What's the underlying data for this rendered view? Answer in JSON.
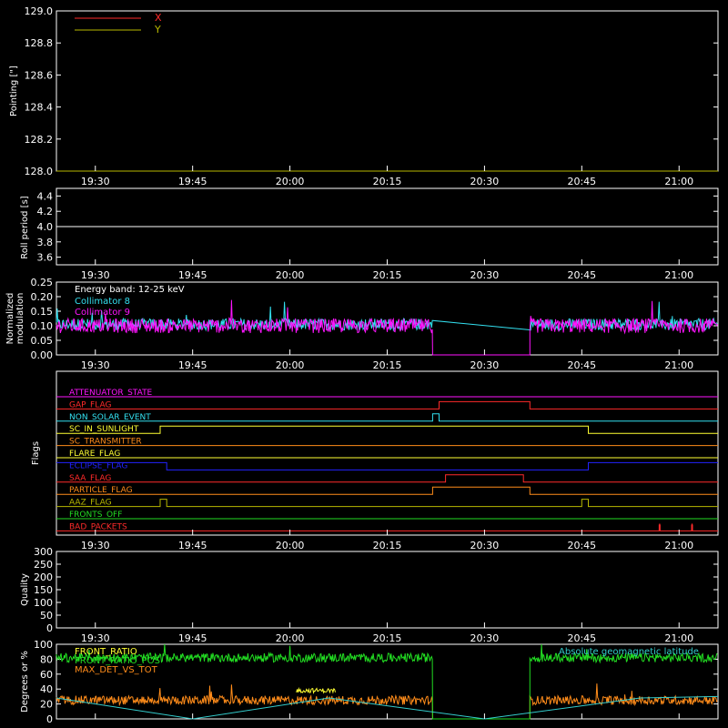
{
  "colors": {
    "background": "#000000",
    "axis": "#ffffff",
    "x": "#ff2a2a",
    "y": "#b8b800",
    "collimator8": "#33e0f0",
    "collimator9": "#ff14ff",
    "front_ratio": "#ffff33",
    "max_det_vs_tot": "#ff8c1a",
    "geomagnetic": "#33cccc",
    "green": "#22dd22"
  },
  "chart_data": [
    {
      "id": "pointing",
      "type": "line",
      "ylabel": "Pointing [\"]",
      "ylim": [
        128.0,
        129.0
      ],
      "yticks": [
        "128.0",
        "128.2",
        "128.4",
        "128.6",
        "128.8",
        "129.0"
      ],
      "xticks": [
        "19:30",
        "19:45",
        "20:00",
        "20:15",
        "20:30",
        "20:45",
        "21:00"
      ],
      "legend": [
        "X",
        "Y"
      ],
      "series": [
        {
          "name": "X",
          "t": [
            "19:24",
            "21:06"
          ],
          "values": [
            128.0,
            128.0
          ]
        },
        {
          "name": "Y",
          "t": [
            "19:24",
            "21:06"
          ],
          "values": [
            128.0,
            128.0
          ]
        }
      ]
    },
    {
      "id": "roll",
      "type": "line",
      "ylabel": "Roll period [s]",
      "ylim": [
        3.5,
        4.5
      ],
      "yticks": [
        "3.6",
        "3.8",
        "4.0",
        "4.2",
        "4.4"
      ],
      "xticks": [
        "19:30",
        "19:45",
        "20:00",
        "20:15",
        "20:30",
        "20:45",
        "21:00"
      ],
      "series": [
        {
          "t": [
            "19:24",
            "21:06"
          ],
          "values": [
            4.0,
            4.0
          ]
        }
      ]
    },
    {
      "id": "modulation",
      "type": "line",
      "ylabel": [
        "Normalized",
        "modulation"
      ],
      "ylim": [
        0.0,
        0.25
      ],
      "yticks": [
        "0.00",
        "0.05",
        "0.10",
        "0.15",
        "0.20",
        "0.25"
      ],
      "xticks": [
        "19:30",
        "19:45",
        "20:00",
        "20:15",
        "20:30",
        "20:45",
        "21:00"
      ],
      "annotation": "Energy band: 12-25 keV",
      "legend": [
        "Collimator 8",
        "Collimator 9"
      ],
      "series": [
        {
          "name": "Collimator 8",
          "segments": [
            [
              "19:24",
              "20:22"
            ],
            [
              "20:37",
              "21:06"
            ]
          ],
          "level": 0.105,
          "noise": 0.02
        },
        {
          "name": "Collimator 9",
          "segments": [
            [
              "19:24",
              "20:22"
            ],
            [
              "20:37",
              "21:06"
            ]
          ],
          "level": 0.1,
          "noise": 0.025,
          "gap_value": 0.0
        }
      ]
    },
    {
      "id": "flags",
      "type": "line",
      "ylabel": "Flags",
      "xticks": [
        "19:30",
        "19:45",
        "20:00",
        "20:15",
        "20:30",
        "20:45",
        "21:00"
      ],
      "flags": [
        {
          "name": "ATTENUATOR_STATE",
          "color": "#ff14ff",
          "steps": [
            [
              "19:24",
              0
            ]
          ]
        },
        {
          "name": "GAP_FLAG",
          "color": "#ff2a2a",
          "steps": [
            [
              "19:24",
              0
            ],
            [
              "20:23",
              1
            ],
            [
              "20:37",
              0
            ]
          ]
        },
        {
          "name": "NON_SOLAR_EVENT",
          "color": "#33e0f0",
          "steps": [
            [
              "19:24",
              0
            ],
            [
              "20:22",
              1
            ],
            [
              "20:23",
              0
            ]
          ]
        },
        {
          "name": "SC_IN_SUNLIGHT",
          "color": "#ffff33",
          "steps": [
            [
              "19:24",
              0
            ],
            [
              "19:40",
              1
            ],
            [
              "20:46",
              0
            ]
          ]
        },
        {
          "name": "SC_TRANSMITTER",
          "color": "#ff8c1a",
          "steps": [
            [
              "19:24",
              0
            ]
          ]
        },
        {
          "name": "FLARE_FLAG",
          "color": "#ffff33",
          "steps": [
            [
              "19:24",
              0
            ]
          ]
        },
        {
          "name": "ECLIPSE_FLAG",
          "color": "#2222ff",
          "steps": [
            [
              "19:24",
              1
            ],
            [
              "19:41",
              0
            ],
            [
              "20:46",
              1
            ]
          ]
        },
        {
          "name": "SAA_FLAG",
          "color": "#ff2a2a",
          "steps": [
            [
              "19:24",
              0
            ],
            [
              "20:24",
              1
            ],
            [
              "20:36",
              0
            ]
          ]
        },
        {
          "name": "PARTICLE_FLAG",
          "color": "#ff8c1a",
          "steps": [
            [
              "19:24",
              0
            ],
            [
              "20:22",
              1
            ],
            [
              "20:37",
              0
            ]
          ]
        },
        {
          "name": "AAZ_FLAG",
          "color": "#b8b800",
          "steps": [
            [
              "19:24",
              0
            ],
            [
              "19:40",
              1
            ],
            [
              "19:41",
              0
            ],
            [
              "20:45",
              1
            ],
            [
              "20:46",
              0
            ]
          ]
        },
        {
          "name": "FRONTS_OFF",
          "color": "#22dd22",
          "steps": [
            [
              "19:24",
              0
            ]
          ]
        },
        {
          "name": "BAD_PACKETS",
          "color": "#ff2a2a",
          "steps": [
            [
              "19:24",
              0
            ],
            [
              "20:57",
              1
            ],
            [
              "20:57",
              0
            ],
            [
              "21:02",
              1
            ],
            [
              "21:02",
              0
            ]
          ]
        }
      ]
    },
    {
      "id": "quality",
      "type": "line",
      "ylabel": "Quality",
      "ylim": [
        0,
        300
      ],
      "yticks": [
        "0",
        "50",
        "100",
        "150",
        "200",
        "250",
        "300"
      ],
      "xticks": [
        "19:30",
        "19:45",
        "20:00",
        "20:15",
        "20:30",
        "20:45",
        "21:00"
      ],
      "series": []
    },
    {
      "id": "front_ratio",
      "type": "line",
      "ylabel": "Degrees or %",
      "ylim": [
        0,
        100
      ],
      "yticks": [
        "0",
        "20",
        "40",
        "60",
        "80",
        "100"
      ],
      "legend": [
        "FRONT_RATIO",
        "FRONT_RATIO_POS",
        "MAX_DET_VS_TOT",
        "Absolute geomagnetic latitude"
      ],
      "series": [
        {
          "name": "FRONT_RATIO",
          "segments": [
            [
              "20:01",
              "20:07"
            ]
          ],
          "level": 38,
          "noise": 3
        },
        {
          "name": "MAX_DET_VS_TOT",
          "segments": [
            [
              "19:24",
              "20:22"
            ],
            [
              "20:37",
              "21:06"
            ]
          ],
          "level": 25,
          "noise": 6,
          "gap_value": 0
        },
        {
          "name": "green",
          "segments": [
            [
              "19:24",
              "20:22"
            ],
            [
              "20:37",
              "21:06"
            ]
          ],
          "level": 82,
          "noise": 6,
          "gap_value": 0
        },
        {
          "name": "Absolute geomagnetic latitude",
          "t": [
            "19:24",
            "19:45",
            "20:06",
            "20:30",
            "20:54",
            "21:06"
          ],
          "values": [
            28,
            0,
            28,
            0,
            28,
            30
          ]
        }
      ]
    }
  ]
}
